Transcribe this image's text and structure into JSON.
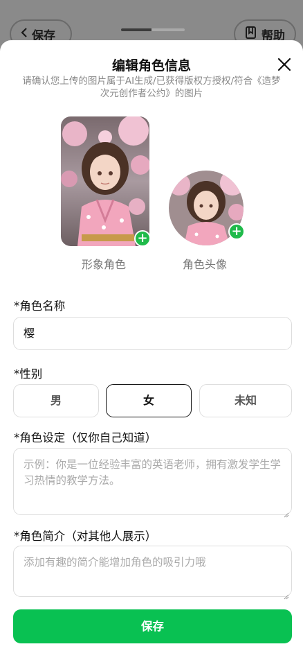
{
  "background": {
    "save_label": "保存",
    "help_label": "帮助"
  },
  "sheet": {
    "title": "编辑角色信息",
    "subtitle": "请确认您上传的图片属于AI生成/已获得版权方授权/符合《造梦次元创作者公约》的图片",
    "image_label": "形象角色",
    "avatar_label": "角色头像",
    "name_label": "*角色名称",
    "name_value": "樱",
    "gender_label": "*性别",
    "gender_options": [
      "男",
      "女",
      "未知"
    ],
    "gender_selected": "女",
    "setting_label": "*角色设定（仅你自己知道）",
    "setting_placeholder": "示例：你是一位经验丰富的英语老师，拥有激发学生学习热情的教学方法。",
    "intro_label": "*角色简介（对其他人展示）",
    "intro_placeholder": "添加有趣的简介能增加角色的吸引力哦",
    "save_button": "保存"
  },
  "colors": {
    "accent": "#09c152",
    "plus_badge": "#1fba4a"
  }
}
